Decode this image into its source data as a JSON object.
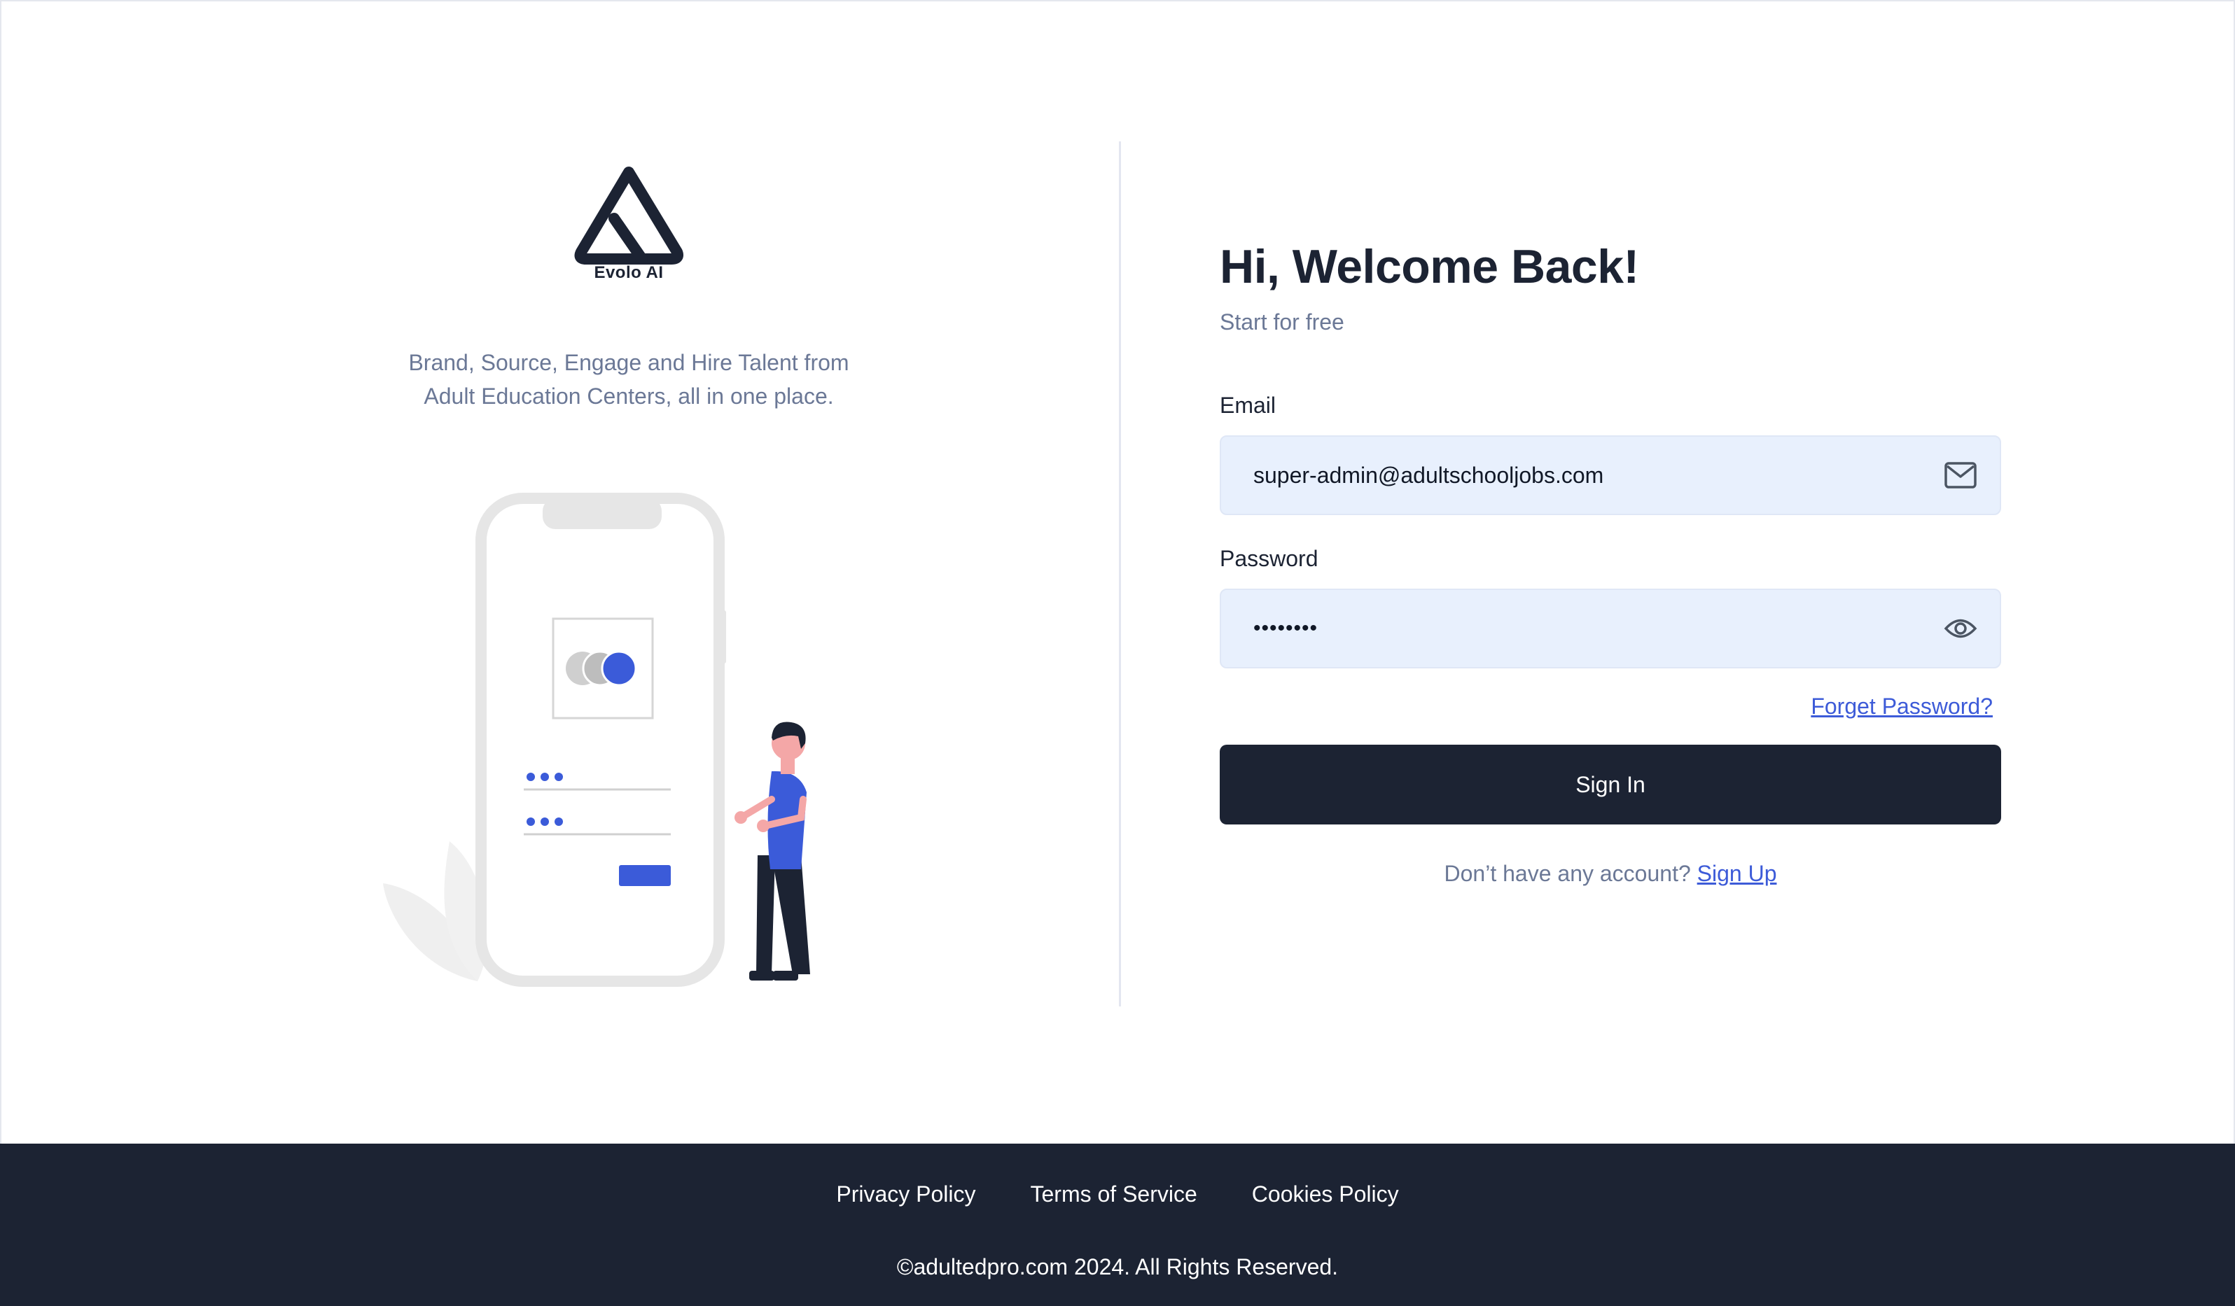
{
  "brand": {
    "logo_text": "Evolo AI",
    "tagline_line1": "Brand, Source, Engage and Hire Talent from",
    "tagline_line2": "Adult Education Centers, all in one place."
  },
  "form": {
    "heading": "Hi, Welcome Back!",
    "subheading": "Start for free",
    "email_label": "Email",
    "email_value": "super-admin@adultschooljobs.com",
    "password_label": "Password",
    "password_value": "••••••••",
    "forgot_label": "Forget Password?",
    "signin_label": "Sign In",
    "signup_prompt": "Don’t have any account?",
    "signup_link": "Sign Up"
  },
  "icons": {
    "email": "mail-icon",
    "password": "eye-icon"
  },
  "footer": {
    "links": [
      "Privacy Policy",
      "Terms of Service",
      "Cookies Policy"
    ],
    "copyright": "©adultedpro.com 2024. All Rights Reserved."
  },
  "colors": {
    "primary_dark": "#1c2333",
    "accent": "#3d5bd8",
    "field_bg": "#e8f0fd",
    "muted_text": "#6b7896"
  }
}
